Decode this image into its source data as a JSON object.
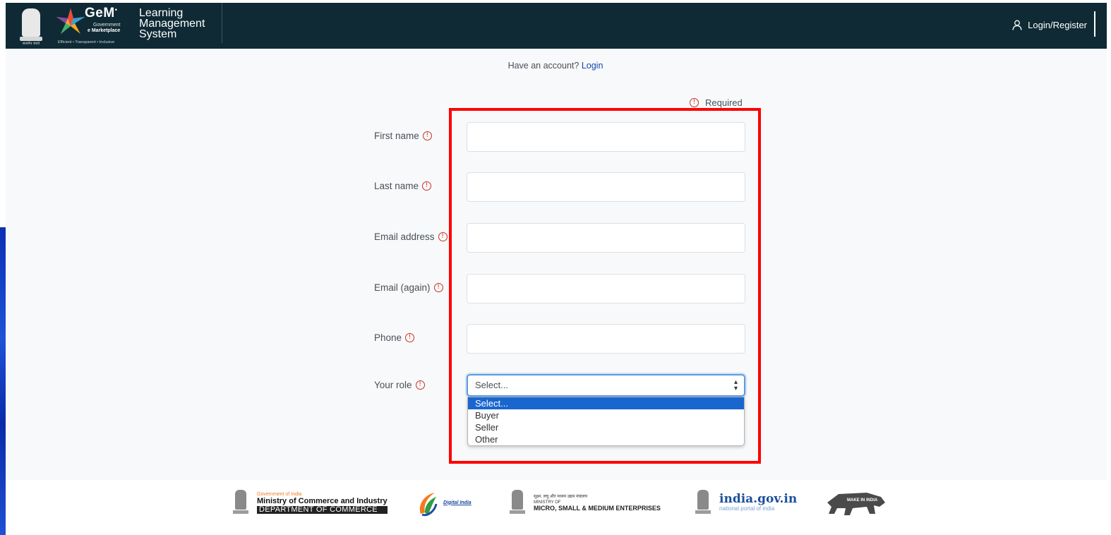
{
  "header": {
    "emblem_text": "सत्यमेव जयते",
    "gem_word": "GeM",
    "gem_sub1": "Government",
    "gem_sub2": "e Marketplace",
    "gem_tagline": "Efficient • Transparent • Inclusive",
    "title_line1": "Learning",
    "title_line2": "Management",
    "title_line3": "System",
    "login_register": "Login/Register"
  },
  "signup": {
    "have_account_text": "Have an account?",
    "login_link": "Login",
    "required_label": "Required"
  },
  "form": {
    "fields": [
      {
        "label": "First name",
        "value": ""
      },
      {
        "label": "Last name",
        "value": ""
      },
      {
        "label": "Email address",
        "value": ""
      },
      {
        "label": "Email (again)",
        "value": ""
      },
      {
        "label": "Phone",
        "value": ""
      }
    ],
    "role": {
      "label": "Your role",
      "selected": "Select...",
      "options": [
        "Select...",
        "Buyer",
        "Seller",
        "Other"
      ]
    }
  },
  "footer": {
    "commerce_top": "Government of India",
    "commerce_mid": "Ministry of Commerce and Industry",
    "commerce_bot": "DEPARTMENT OF COMMERCE",
    "digital_india": "Digital India",
    "msme_hindi": "सूक्ष्म, लघु और मध्यम उद्यम मंत्रालय",
    "msme_ministry": "MINISTRY OF",
    "msme_main": "MICRO, SMALL & MEDIUM ENTERPRISES",
    "igov_main": "india.gov.in",
    "igov_sub": "national portal of india",
    "make_in_india": "MAKE IN INDIA"
  },
  "colors": {
    "navbar": "#0f2a35",
    "link": "#0f47ad",
    "required_icon": "#ca3120",
    "highlight": "#ff0000",
    "dropdown_selected": "#1a66cf"
  }
}
